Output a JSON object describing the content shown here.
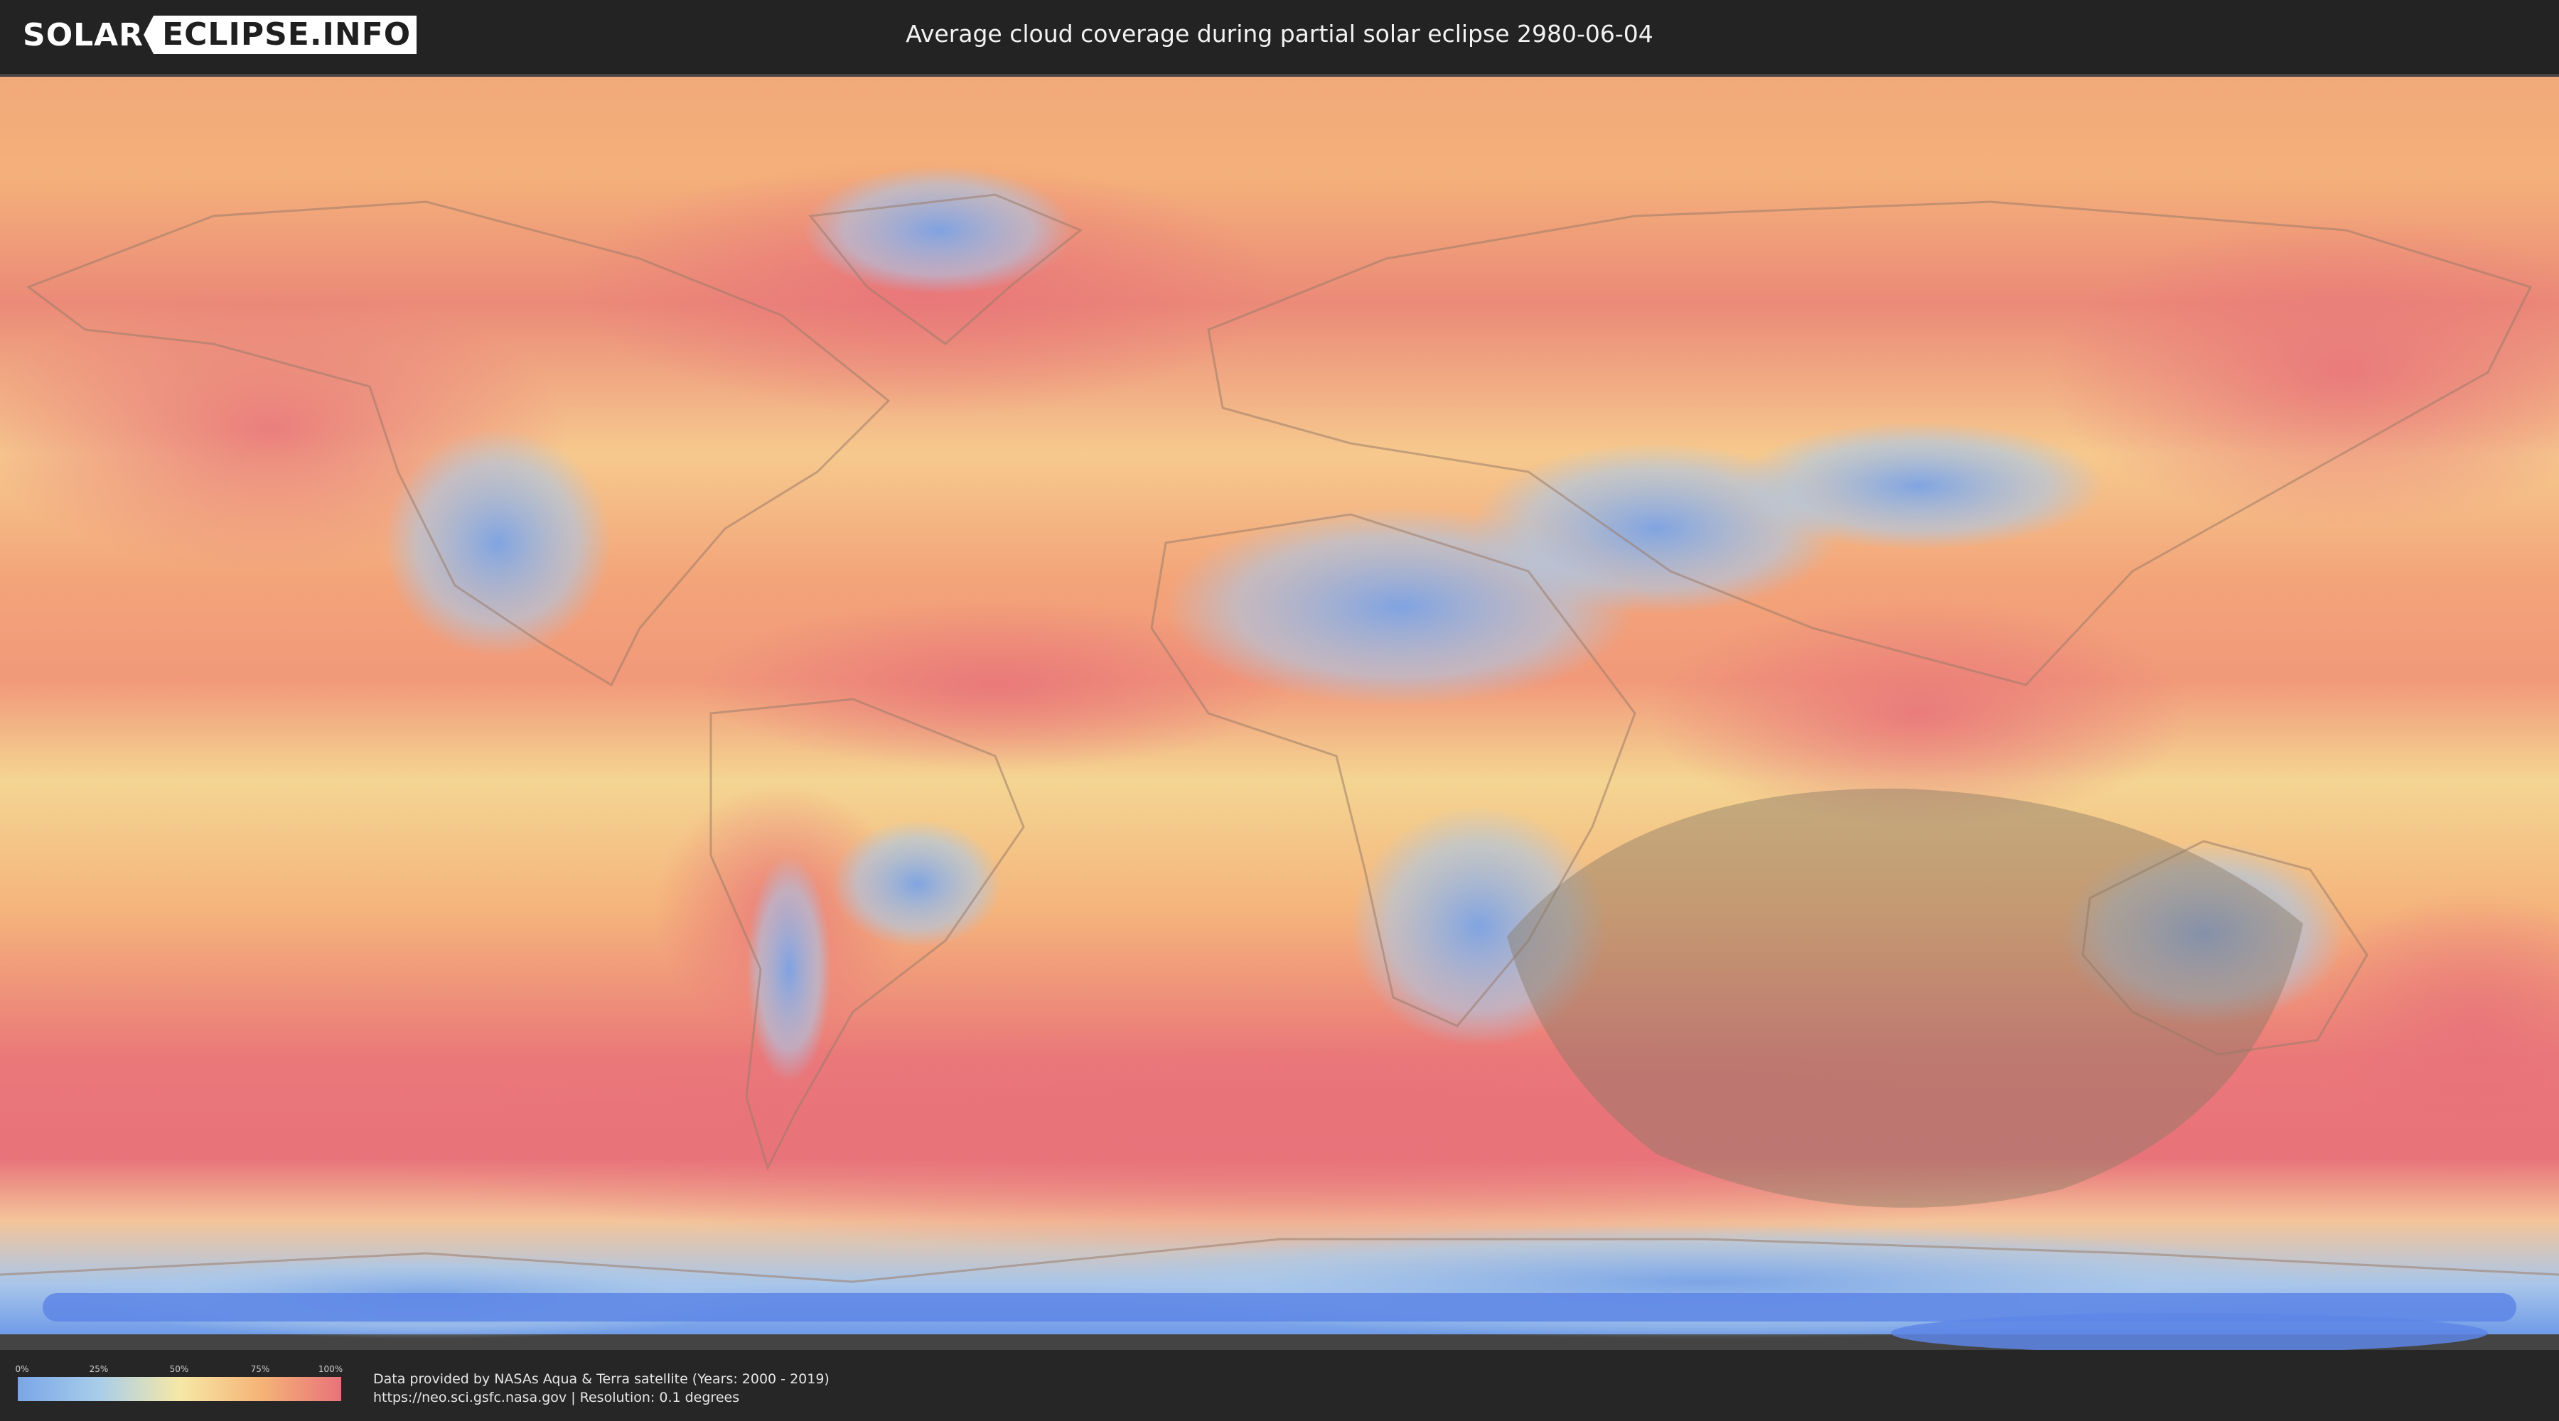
{
  "header": {
    "logo_left": "SOLAR",
    "logo_right": "ECLIPSE.INFO",
    "title": "Average cloud coverage during partial solar eclipse 2980-06-04"
  },
  "legend": {
    "ticks": [
      "0%",
      "25%",
      "50%",
      "75%",
      "100%"
    ],
    "colors": [
      "#7aa6e8",
      "#a8cdea",
      "#f6e8a6",
      "#f5b477",
      "#e8737a"
    ]
  },
  "footer": {
    "credit_line1": "Data provided by NASAs Aqua & Terra satellite (Years: 2000 - 2019)",
    "credit_line2": "https://neo.sci.gsfc.nasa.gov | Resolution: 0.1 degrees"
  },
  "map": {
    "layer": "average cloud coverage",
    "overlay": "partial eclipse visibility zone",
    "colors": {
      "clear": "#6f9be8",
      "low": "#a8cdea",
      "mid": "#f6e3a0",
      "high": "#f5ad78",
      "overcast": "#e9757a",
      "eclipse_zone": "#8a7a66",
      "antarctic_band": "#5d86e6"
    }
  }
}
